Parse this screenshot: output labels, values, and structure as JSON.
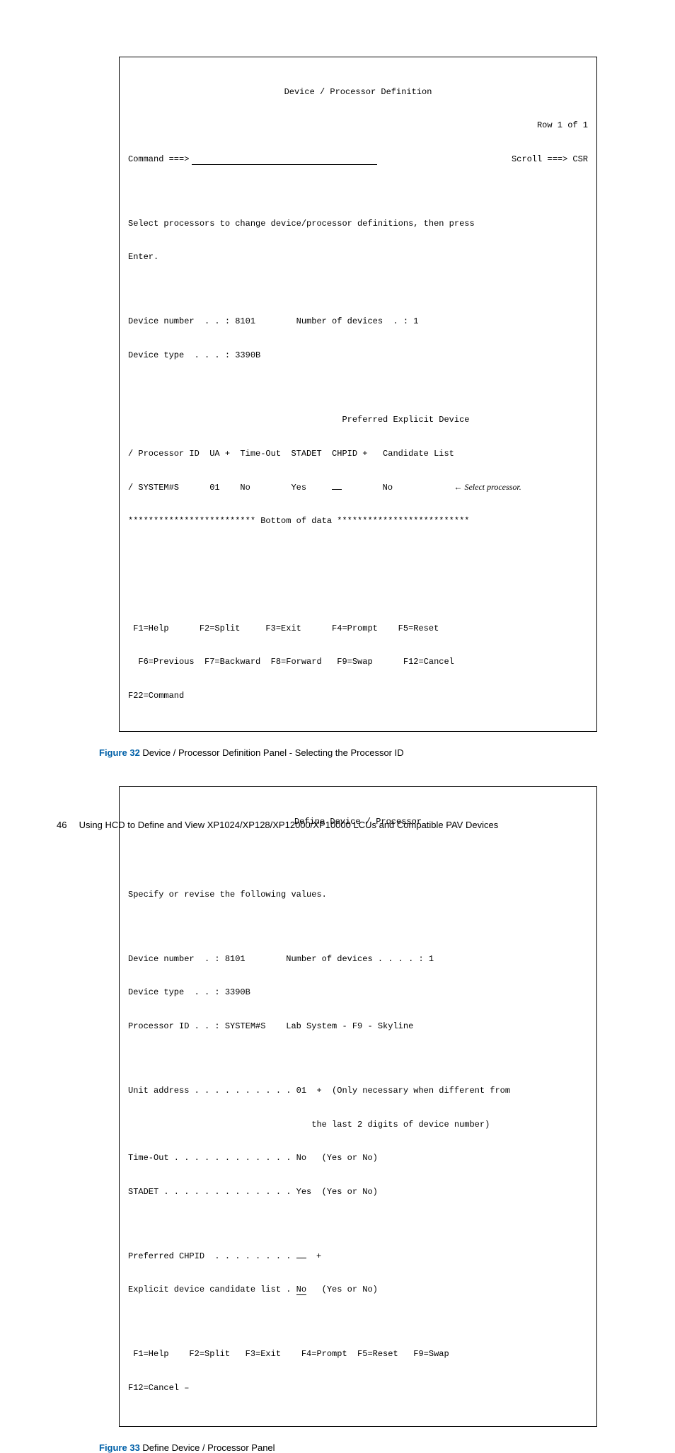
{
  "panel1": {
    "title": "Device / Processor Definition",
    "row_info": "Row 1 of 1",
    "command_label": "Command ===>",
    "scroll_label": "Scroll ===> CSR",
    "instruction1": "Select processors to change device/processor definitions, then press",
    "instruction2": "Enter.",
    "dev_num_label": "Device number  . . : 8101",
    "num_dev_label": "Number of devices  . : 1",
    "dev_type_label": "Device type  . . . : 3390B",
    "colhead1": "                                          Preferred Explicit Device",
    "colhead2": "/ Processor ID  UA +  Time-Out  STADET  CHPID +   Candidate List",
    "row": "/ SYSTEM#S      01    No        Yes     ",
    "row_after_under": "        No            ",
    "row_note_arrow": "← ",
    "row_note": "Select processor.",
    "bottom": "************************* Bottom of data **************************",
    "fkeys1": " F1=Help      F2=Split     F3=Exit      F4=Prompt    F5=Reset",
    "fkeys2": "  F6=Previous  F7=Backward  F8=Forward   F9=Swap      F12=Cancel",
    "fkeys3": "F22=Command"
  },
  "caption1_num": "Figure 32",
  "caption1_text": "  Device / Processor Definition Panel - Selecting the Processor ID",
  "panel2": {
    "title": "Define Device / Processor",
    "instruction": "Specify or revise the following values.",
    "dev_num": "Device number  . : 8101        Number of devices . . . . : 1",
    "dev_type": "Device type  . . : 3390B",
    "proc_id": "Processor ID . . : SYSTEM#S    Lab System - F9 - Skyline",
    "unit_addr": "Unit address . . . . . . . . . . 01  +  (Only necessary when different from",
    "unit_addr_2": "                                    the last 2 digits of device number)",
    "timeout": "Time-Out . . . . . . . . . . . . No   (Yes or No)",
    "stadet": "STADET . . . . . . . . . . . . . Yes  (Yes or No)",
    "pref_chpid_pre": "Preferred CHPID  . . . . . . . . ",
    "pref_chpid_post": "  +",
    "expl_pre": "Explicit device candidate list . ",
    "expl_val": "No",
    "expl_post": "   (Yes or No)",
    "fkeys1": " F1=Help    F2=Split   F3=Exit    F4=Prompt  F5=Reset   F9=Swap",
    "fkeys2": "F12=Cancel –"
  },
  "caption2_num": "Figure 33",
  "caption2_text": "  Define Device / Processor Panel",
  "footer_pagenum": "46",
  "footer_text": "Using HCD to Define and View XP1024/XP128/XP12000/XP10000 LCUs and Compatible PAV Devices"
}
